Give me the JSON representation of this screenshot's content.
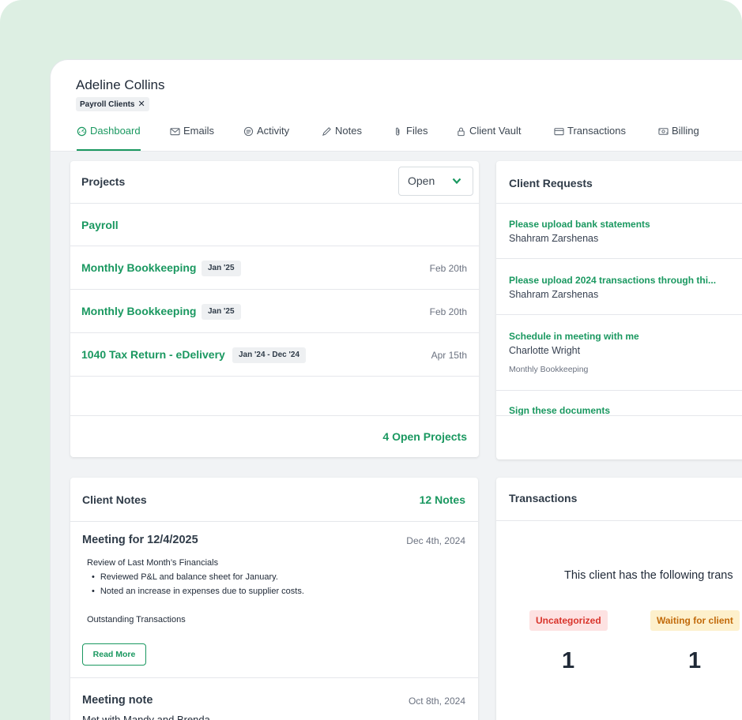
{
  "client": {
    "name": "Adeline Collins",
    "tag": "Payroll Clients",
    "tag_remove": "✕"
  },
  "tabs": [
    {
      "label": "Dashboard",
      "icon": "dashboard-icon",
      "active": true
    },
    {
      "label": "Emails",
      "icon": "mail-icon"
    },
    {
      "label": "Activity",
      "icon": "activity-icon"
    },
    {
      "label": "Notes",
      "icon": "pencil-icon"
    },
    {
      "label": "Files",
      "icon": "paperclip-icon"
    },
    {
      "label": "Client Vault",
      "icon": "lock-icon"
    },
    {
      "label": "Transactions",
      "icon": "card-icon"
    },
    {
      "label": "Billing",
      "icon": "billing-icon"
    }
  ],
  "projects": {
    "title": "Projects",
    "filter": "Open",
    "items": [
      {
        "name": "Payroll",
        "period": "",
        "date": ""
      },
      {
        "name": "Monthly Bookkeeping",
        "period": "Jan '25",
        "date": "Feb 20th"
      },
      {
        "name": "Monthly Bookkeeping",
        "period": "Jan '25",
        "date": "Feb 20th"
      },
      {
        "name": "1040 Tax Return - eDelivery",
        "period": "Jan '24 - Dec '24",
        "date": "Apr 15th"
      }
    ],
    "footer": "4 Open Projects"
  },
  "requests": {
    "title": "Client Requests",
    "items": [
      {
        "title": "Please upload bank statements",
        "person": "Shahram Zarshenas",
        "project": ""
      },
      {
        "title": "Please upload 2024 transactions through thi...",
        "person": "Shahram Zarshenas",
        "project": ""
      },
      {
        "title": "Schedule in meeting with me",
        "person": "Charlotte Wright",
        "project": "Monthly Bookkeeping"
      },
      {
        "title": "Sign these documents",
        "person": "",
        "project": ""
      }
    ]
  },
  "notes": {
    "title": "Client Notes",
    "count": "12 Notes",
    "items": [
      {
        "title": "Meeting for 12/4/2025",
        "date": "Dec 4th, 2024",
        "heading": "Review of Last Month’s Financials",
        "bullets": [
          "Reviewed P&L and balance sheet for January.",
          "Noted an increase in expenses due to supplier costs."
        ],
        "extra": "Outstanding Transactions",
        "button": "Read More"
      },
      {
        "title": "Meeting note",
        "date": "Oct 8th, 2024",
        "preview": "Met with Mandy and Brenda"
      }
    ]
  },
  "transactions": {
    "title": "Transactions",
    "message": "This client has the following trans",
    "statuses": [
      {
        "label": "Uncategorized",
        "count": "1",
        "bg": "#fde2e2",
        "fg": "#d9342b"
      },
      {
        "label": "Waiting for client",
        "count": "1",
        "bg": "#fdf0cc",
        "fg": "#c26a0a"
      }
    ]
  },
  "colors": {
    "accent": "#1a9860",
    "backdrop": "#ddefe3"
  }
}
